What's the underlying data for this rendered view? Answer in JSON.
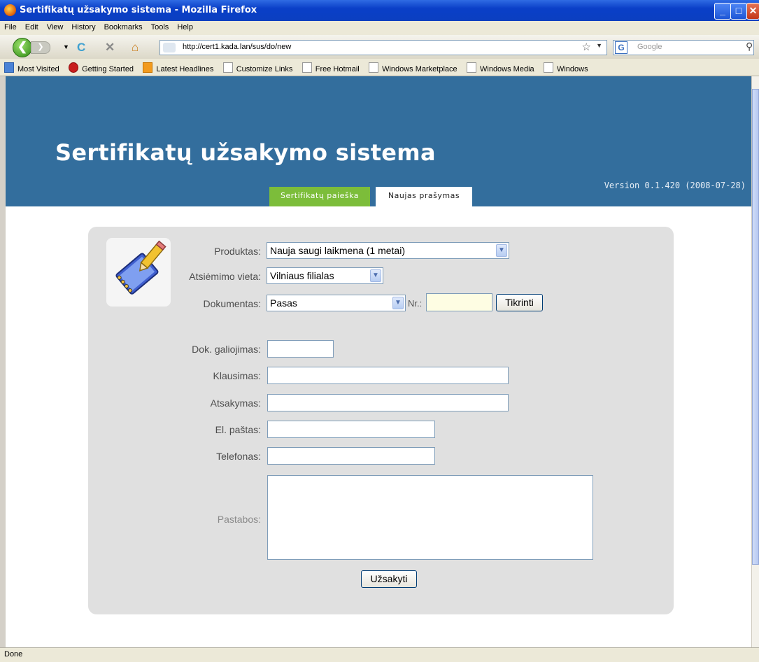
{
  "window": {
    "title": "Sertifikatų užsakymo sistema - Mozilla Firefox",
    "minimize_symbol": "_",
    "maximize_symbol": "□",
    "close_symbol": "✕"
  },
  "menu": [
    "File",
    "Edit",
    "View",
    "History",
    "Bookmarks",
    "Tools",
    "Help"
  ],
  "navbar": {
    "url": "http://cert1.kada.lan/sus/do/new",
    "search_placeholder": "Google",
    "search_engine_glyph": "G"
  },
  "bookmarks": [
    {
      "label": "Most Visited",
      "icon": "most-visited-icon"
    },
    {
      "label": "Getting Started",
      "icon": "firefox-icon"
    },
    {
      "label": "Latest Headlines",
      "icon": "rss-icon"
    },
    {
      "label": "Customize Links",
      "icon": "page-icon"
    },
    {
      "label": "Free Hotmail",
      "icon": "page-icon"
    },
    {
      "label": "Windows Marketplace",
      "icon": "page-icon"
    },
    {
      "label": "Windows Media",
      "icon": "page-icon"
    },
    {
      "label": "Windows",
      "icon": "page-icon"
    }
  ],
  "page": {
    "heading": "Sertifikatų užsakymo sistema",
    "version": "Version 0.1.420 (2008-07-28)",
    "tabs": [
      {
        "label": "Sertifikatų paieška",
        "active": false,
        "color": "#7cbd3a"
      },
      {
        "label": "Naujas prašymas",
        "active": true
      }
    ],
    "header_color": "#336e9d"
  },
  "form": {
    "product_label": "Produktas:",
    "product_value": "Nauja saugi laikmena (1 metai)",
    "pickup_label": "Atsiėmimo vieta:",
    "pickup_value": "Vilniaus filialas",
    "document_label": "Dokumentas:",
    "document_value": "Pasas",
    "nr_label": "Nr.:",
    "nr_value": "",
    "check_button": "Tikrinti",
    "validity_label": "Dok. galiojimas:",
    "validity_value": "",
    "question_label": "Klausimas:",
    "question_value": "",
    "answer_label": "Atsakymas:",
    "answer_value": "",
    "email_label": "El. paštas:",
    "email_value": "",
    "phone_label": "Telefonas:",
    "phone_value": "",
    "notes_label": "Pastabos:",
    "notes_value": "",
    "submit_button": "Užsakyti"
  },
  "status": "Done"
}
